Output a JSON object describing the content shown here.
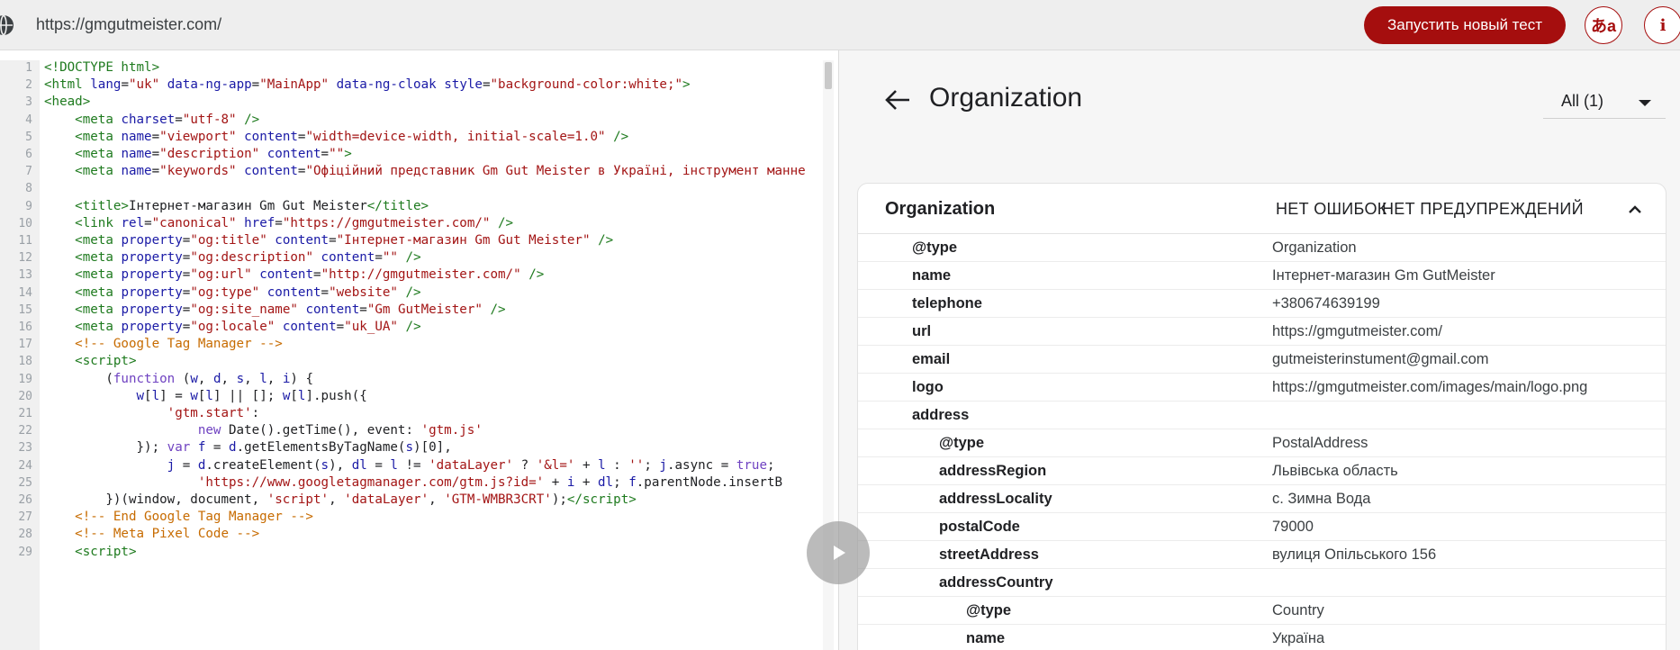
{
  "topbar": {
    "url": "https://gmgutmeister.com/",
    "run_button": "Запустить новый тест",
    "translate_glyph": "あa",
    "info_glyph": "i",
    "accent": "#a50e0e"
  },
  "code": {
    "lines": [
      {
        "n": "1",
        "html": "<span class=\"t\">&lt;!DOCTYPE html&gt;</span>"
      },
      {
        "n": "2",
        "html": "<span class=\"t\">&lt;html</span> <span class=\"a\">lang</span>=<span class=\"s\">\"uk\"</span> <span class=\"a\">data-ng-app</span>=<span class=\"s\">\"MainApp\"</span> <span class=\"a\">data-ng-cloak</span> <span class=\"a\">style</span>=<span class=\"s\">\"background-color:white;\"</span><span class=\"t\">&gt;</span>"
      },
      {
        "n": "3",
        "html": "<span class=\"t\">&lt;head&gt;</span>"
      },
      {
        "n": "4",
        "html": "    <span class=\"t\">&lt;meta</span> <span class=\"a\">charset</span>=<span class=\"s\">\"utf-8\"</span> <span class=\"t\">/&gt;</span>"
      },
      {
        "n": "5",
        "html": "    <span class=\"t\">&lt;meta</span> <span class=\"a\">name</span>=<span class=\"s\">\"viewport\"</span> <span class=\"a\">content</span>=<span class=\"s\">\"width=device-width, initial-scale=1.0\"</span> <span class=\"t\">/&gt;</span>"
      },
      {
        "n": "6",
        "html": "    <span class=\"t\">&lt;meta</span> <span class=\"a\">name</span>=<span class=\"s\">\"description\"</span> <span class=\"a\">content</span>=<span class=\"s\">\"\"</span><span class=\"t\">&gt;</span>"
      },
      {
        "n": "7",
        "html": "    <span class=\"t\">&lt;meta</span> <span class=\"a\">name</span>=<span class=\"s\">\"keywords\"</span> <span class=\"a\">content</span>=<span class=\"s\">\"Офіційний представник Gm Gut Meister в Україні, інструмент манне</span>"
      },
      {
        "n": "8",
        "html": ""
      },
      {
        "n": "9",
        "html": "    <span class=\"t\">&lt;title&gt;</span>Інтернет-магазин Gm Gut Meister<span class=\"t\">&lt;/title&gt;</span>"
      },
      {
        "n": "10",
        "html": "    <span class=\"t\">&lt;link</span> <span class=\"a\">rel</span>=<span class=\"s\">\"canonical\"</span> <span class=\"a\">href</span>=<span class=\"s\">\"https://gmgutmeister.com/\"</span> <span class=\"t\">/&gt;</span>"
      },
      {
        "n": "11",
        "html": "    <span class=\"t\">&lt;meta</span> <span class=\"a\">property</span>=<span class=\"s\">\"og:title\"</span> <span class=\"a\">content</span>=<span class=\"s\">\"Інтернет-магазин Gm Gut Meister\"</span> <span class=\"t\">/&gt;</span>"
      },
      {
        "n": "12",
        "html": "    <span class=\"t\">&lt;meta</span> <span class=\"a\">property</span>=<span class=\"s\">\"og:description\"</span> <span class=\"a\">content</span>=<span class=\"s\">\"\"</span> <span class=\"t\">/&gt;</span>"
      },
      {
        "n": "13",
        "html": "    <span class=\"t\">&lt;meta</span> <span class=\"a\">property</span>=<span class=\"s\">\"og:url\"</span> <span class=\"a\">content</span>=<span class=\"s\">\"http://gmgutmeister.com/\"</span> <span class=\"t\">/&gt;</span>"
      },
      {
        "n": "14",
        "html": "    <span class=\"t\">&lt;meta</span> <span class=\"a\">property</span>=<span class=\"s\">\"og:type\"</span> <span class=\"a\">content</span>=<span class=\"s\">\"website\"</span> <span class=\"t\">/&gt;</span>"
      },
      {
        "n": "15",
        "html": "    <span class=\"t\">&lt;meta</span> <span class=\"a\">property</span>=<span class=\"s\">\"og:site_name\"</span> <span class=\"a\">content</span>=<span class=\"s\">\"Gm GutMeister\"</span> <span class=\"t\">/&gt;</span>"
      },
      {
        "n": "16",
        "html": "    <span class=\"t\">&lt;meta</span> <span class=\"a\">property</span>=<span class=\"s\">\"og:locale\"</span> <span class=\"a\">content</span>=<span class=\"s\">\"uk_UA\"</span> <span class=\"t\">/&gt;</span>"
      },
      {
        "n": "17",
        "html": "    <span class=\"c\">&lt;!-- Google Tag Manager --&gt;</span>"
      },
      {
        "n": "18",
        "html": "    <span class=\"t\">&lt;script&gt;</span>"
      },
      {
        "n": "19",
        "html": "        (<span class=\"k\">function</span> (<span class=\"a\">w</span>, <span class=\"a\">d</span>, <span class=\"a\">s</span>, <span class=\"a\">l</span>, <span class=\"a\">i</span>) {"
      },
      {
        "n": "20",
        "html": "            <span class=\"a\">w</span>[<span class=\"a\">l</span>] = <span class=\"a\">w</span>[<span class=\"a\">l</span>] || []; <span class=\"a\">w</span>[<span class=\"a\">l</span>].push({"
      },
      {
        "n": "21",
        "html": "                <span class=\"s\">'gtm.start'</span>:"
      },
      {
        "n": "22",
        "html": "                    <span class=\"k\">new</span> Date().getTime(), event: <span class=\"s\">'gtm.js'</span>"
      },
      {
        "n": "23",
        "html": "            }); <span class=\"k\">var</span> <span class=\"a\">f</span> = <span class=\"a\">d</span>.getElementsByTagName(<span class=\"a\">s</span>)[0],"
      },
      {
        "n": "24",
        "html": "                <span class=\"a\">j</span> = <span class=\"a\">d</span>.createElement(<span class=\"a\">s</span>), <span class=\"a\">dl</span> = <span class=\"a\">l</span> != <span class=\"s\">'dataLayer'</span> ? <span class=\"s\">'&amp;l='</span> + <span class=\"a\">l</span> : <span class=\"s\">''</span>; <span class=\"a\">j</span>.async = <span class=\"k\">true</span>;"
      },
      {
        "n": "25",
        "html": "                    <span class=\"s\">'https://www.googletagmanager.com/gtm.js?id='</span> + <span class=\"a\">i</span> + <span class=\"a\">dl</span>; <span class=\"a\">f</span>.parentNode.insertB"
      },
      {
        "n": "26",
        "html": "        })(window, document, <span class=\"s\">'script'</span>, <span class=\"s\">'dataLayer'</span>, <span class=\"s\">'GTM-WMBR3CRT'</span>);<span class=\"t\">&lt;/script&gt;</span>"
      },
      {
        "n": "27",
        "html": "    <span class=\"c\">&lt;!-- End Google Tag Manager --&gt;</span>"
      },
      {
        "n": "28",
        "html": "    <span class=\"c\">&lt;!-- Meta Pixel Code --&gt;</span>"
      },
      {
        "n": "29",
        "html": "    <span class=\"t\">&lt;script&gt;</span>"
      }
    ]
  },
  "panel": {
    "title": "Organization",
    "filter_label": "All (1)",
    "card": {
      "title": "Organization",
      "errors": "НЕТ ОШИБОК",
      "warnings": "НЕТ ПРЕДУПРЕЖДЕНИЙ",
      "rows": [
        {
          "key": "@type",
          "value": "Organization",
          "level": 0
        },
        {
          "key": "name",
          "value": "Інтернет-магазин Gm GutMeister",
          "level": 0
        },
        {
          "key": "telephone",
          "value": "+380674639199",
          "level": 0
        },
        {
          "key": "url",
          "value": "https://gmgutmeister.com/",
          "level": 0
        },
        {
          "key": "email",
          "value": "gutmeisterinstument@gmail.com",
          "level": 0
        },
        {
          "key": "logo",
          "value": "https://gmgutmeister.com/images/main/logo.png",
          "level": 0
        },
        {
          "key": "address",
          "value": "",
          "level": 0
        },
        {
          "key": "@type",
          "value": "PostalAddress",
          "level": 1
        },
        {
          "key": "addressRegion",
          "value": "Львівська область",
          "level": 1
        },
        {
          "key": "addressLocality",
          "value": "с. Зимна Вода",
          "level": 1
        },
        {
          "key": "postalCode",
          "value": "79000",
          "level": 1
        },
        {
          "key": "streetAddress",
          "value": "вулиця Опільського 156",
          "level": 1
        },
        {
          "key": "addressCountry",
          "value": "",
          "level": 1
        },
        {
          "key": "@type",
          "value": "Country",
          "level": 2
        },
        {
          "key": "name",
          "value": "Україна",
          "level": 2
        }
      ]
    }
  }
}
